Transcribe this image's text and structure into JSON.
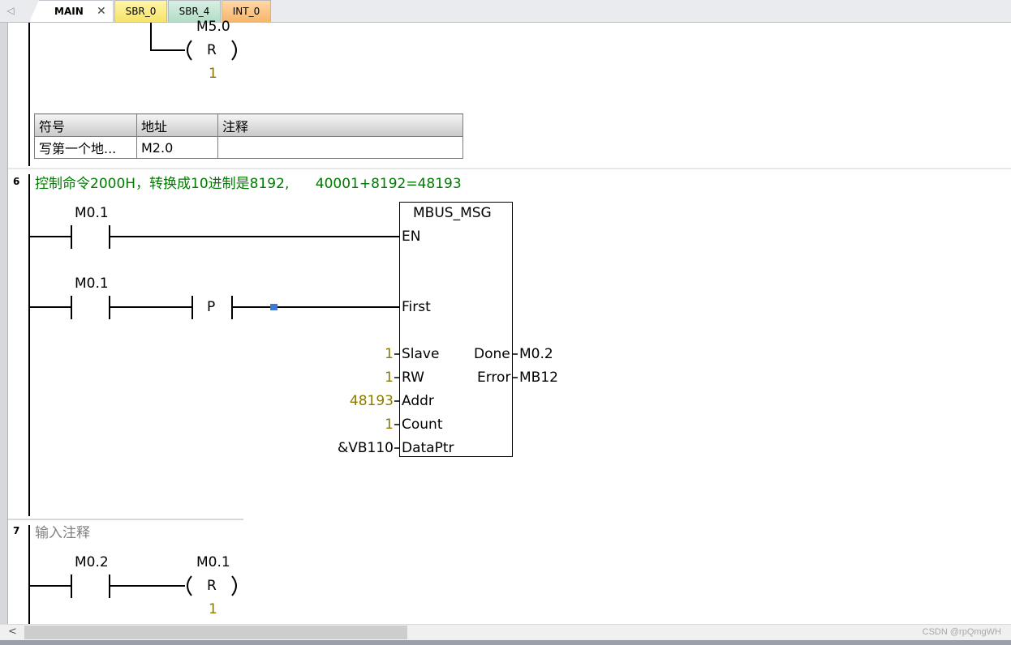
{
  "tabs": [
    {
      "label": "MAIN",
      "active": true
    },
    {
      "label": "SBR_0",
      "color": "#f6e36a"
    },
    {
      "label": "SBR_4",
      "color": "#b3ddc7"
    },
    {
      "label": "INT_0",
      "color": "#f6b56a"
    }
  ],
  "tab_close_glyph": "✕",
  "network5": {
    "coil_address": "M5.0",
    "coil_type": "R",
    "coil_count": "1",
    "symbol_table": {
      "headers": [
        "符号",
        "地址",
        "注释"
      ],
      "rows": [
        [
          "写第一个地...",
          "M2.0",
          ""
        ]
      ]
    }
  },
  "network6": {
    "number": "6",
    "comment": "控制命令2000H，转换成10进制是8192,      40001+8192=48193",
    "contact1": "M0.1",
    "contact2": "M0.1",
    "pulse_label": "P",
    "block": {
      "title": "MBUS_MSG",
      "pins_left": [
        "EN",
        "First",
        "Slave",
        "RW",
        "Addr",
        "Count",
        "DataPtr"
      ],
      "pins_right": [
        "Done",
        "Error"
      ],
      "inputs": {
        "Slave": "1",
        "RW": "1",
        "Addr": "48193",
        "Count": "1",
        "DataPtr": "&VB110"
      },
      "outputs": {
        "Done": "M0.2",
        "Error": "MB12"
      }
    }
  },
  "network7": {
    "number": "7",
    "comment": "输入注释",
    "contact": "M0.2",
    "coil_address": "M0.1",
    "coil_type": "R",
    "coil_count": "1"
  },
  "scrollbar": {
    "left_arrow": "<"
  },
  "watermark": "CSDN @rpQmgWH"
}
